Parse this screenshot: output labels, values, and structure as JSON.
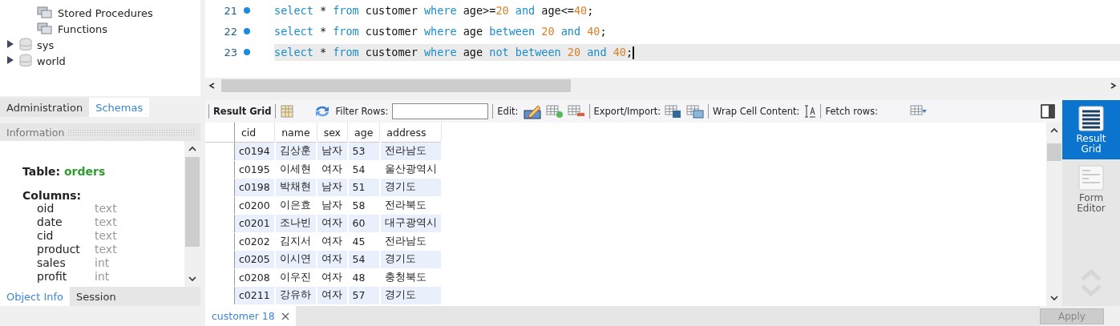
{
  "navigator": {
    "tree": [
      {
        "label": "Stored Procedures",
        "kind": "folder"
      },
      {
        "label": "Functions",
        "kind": "folder"
      },
      {
        "label": "sys",
        "kind": "schema",
        "expanded": false
      },
      {
        "label": "world",
        "kind": "schema",
        "expanded": false
      }
    ],
    "tabs": [
      {
        "label": "Administration",
        "selected": false
      },
      {
        "label": "Schemas",
        "selected": true
      }
    ]
  },
  "information": {
    "title": "Information",
    "table_label": "Table:",
    "table_name": "orders",
    "columns_label": "Columns:",
    "columns": [
      {
        "name": "oid",
        "type": "text"
      },
      {
        "name": "date",
        "type": "text"
      },
      {
        "name": "cid",
        "type": "text"
      },
      {
        "name": "product",
        "type": "text"
      },
      {
        "name": "sales",
        "type": "int"
      },
      {
        "name": "profit",
        "type": "int"
      }
    ],
    "tabs": [
      {
        "label": "Object Info",
        "selected": true
      },
      {
        "label": "Session",
        "selected": false
      }
    ]
  },
  "editor": {
    "lines": [
      {
        "number": "21",
        "current": false,
        "tokens": [
          {
            "text": "select",
            "kind": "keyword"
          },
          {
            "text": " * ",
            "kind": "plain"
          },
          {
            "text": "from",
            "kind": "keyword"
          },
          {
            "text": " customer ",
            "kind": "plain"
          },
          {
            "text": "where",
            "kind": "keyword"
          },
          {
            "text": " age>=",
            "kind": "plain"
          },
          {
            "text": "20",
            "kind": "number"
          },
          {
            "text": " and",
            "kind": "keyword"
          },
          {
            "text": " age<=",
            "kind": "plain"
          },
          {
            "text": "40",
            "kind": "number"
          },
          {
            "text": ";",
            "kind": "plain"
          }
        ]
      },
      {
        "number": "22",
        "current": false,
        "tokens": [
          {
            "text": "select",
            "kind": "keyword"
          },
          {
            "text": " * ",
            "kind": "plain"
          },
          {
            "text": "from",
            "kind": "keyword"
          },
          {
            "text": " customer ",
            "kind": "plain"
          },
          {
            "text": "where",
            "kind": "keyword"
          },
          {
            "text": " age ",
            "kind": "plain"
          },
          {
            "text": "between",
            "kind": "keyword"
          },
          {
            "text": " 20",
            "kind": "number"
          },
          {
            "text": " and",
            "kind": "keyword"
          },
          {
            "text": " 40",
            "kind": "number"
          },
          {
            "text": ";",
            "kind": "plain"
          }
        ]
      },
      {
        "number": "23",
        "current": true,
        "tokens": [
          {
            "text": "select",
            "kind": "keyword"
          },
          {
            "text": " * ",
            "kind": "plain"
          },
          {
            "text": "from",
            "kind": "keyword"
          },
          {
            "text": " customer ",
            "kind": "plain"
          },
          {
            "text": "where",
            "kind": "keyword"
          },
          {
            "text": " age ",
            "kind": "plain"
          },
          {
            "text": "not between",
            "kind": "keyword"
          },
          {
            "text": " 20",
            "kind": "number"
          },
          {
            "text": " and",
            "kind": "keyword"
          },
          {
            "text": " 40",
            "kind": "number"
          },
          {
            "text": ";",
            "kind": "plain"
          }
        ]
      }
    ]
  },
  "toolbar": {
    "result_grid": "Result Grid",
    "filter_label": "Filter Rows:",
    "edit_label": "Edit:",
    "export_label": "Export/Import:",
    "wrap_label": "Wrap Cell Content:",
    "fetch_label": "Fetch rows:"
  },
  "grid": {
    "columns": [
      "cid",
      "name",
      "sex",
      "age",
      "address"
    ],
    "rows": [
      [
        "c0194",
        "김상훈",
        "남자",
        "53",
        "전라남도"
      ],
      [
        "c0195",
        "이세현",
        "여자",
        "54",
        "울산광역시"
      ],
      [
        "c0198",
        "박채현",
        "남자",
        "51",
        "경기도"
      ],
      [
        "c0200",
        "이은효",
        "남자",
        "58",
        "전라북도"
      ],
      [
        "c0201",
        "조나빈",
        "여자",
        "60",
        "대구광역시"
      ],
      [
        "c0202",
        "김지서",
        "여자",
        "45",
        "전라남도"
      ],
      [
        "c0205",
        "이시연",
        "여자",
        "54",
        "경기도"
      ],
      [
        "c0208",
        "이우진",
        "여자",
        "48",
        "충청북도"
      ],
      [
        "c0211",
        "강유하",
        "여자",
        "57",
        "경기도"
      ]
    ]
  },
  "side_panel": [
    {
      "label": "Result Grid",
      "selected": true
    },
    {
      "label": "Form Editor",
      "selected": false
    }
  ],
  "result_tabs": [
    {
      "label": "customer 18",
      "selected": true
    }
  ],
  "apply_button": {
    "label": "Apply",
    "disabled": true
  }
}
